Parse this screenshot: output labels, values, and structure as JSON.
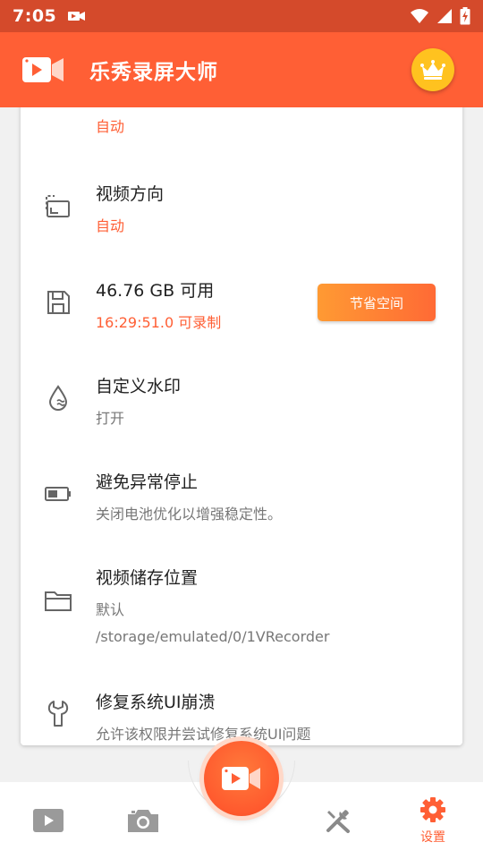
{
  "status_bar": {
    "time": "7:05"
  },
  "app_bar": {
    "title": "乐秀录屏大师"
  },
  "settings": {
    "partial_row": {
      "value": "自动"
    },
    "video_orientation": {
      "title": "视频方向",
      "value": "自动"
    },
    "storage": {
      "title": "46.76 GB 可用",
      "value": "16:29:51.0 可录制",
      "button_label": "节省空间"
    },
    "watermark": {
      "title": "自定义水印",
      "value": "打开"
    },
    "prevent_stop": {
      "title": "避免异常停止",
      "value": "关闭电池优化以增强稳定性。"
    },
    "storage_location": {
      "title": "视频储存位置",
      "value": "默认",
      "path": "/storage/emulated/0/1VRecorder"
    },
    "fix_ui_crash": {
      "title": "修复系统UI崩溃",
      "value": "允许该权限并尝试修复系统UI问题"
    }
  },
  "bottom_nav": {
    "settings_label": "设置"
  },
  "colors": {
    "accent": "#ff5f35",
    "status_bar": "#d44a2b",
    "crown": "#ffc21f"
  }
}
